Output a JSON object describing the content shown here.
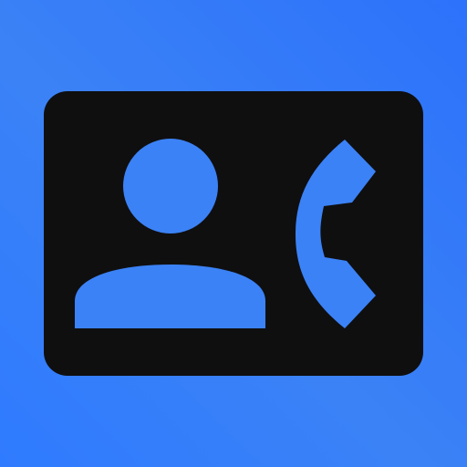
{
  "icon": {
    "name": "contact-phone-icon",
    "background_color": "#3b82f6",
    "card_color": "#0f0f10",
    "glyph_color": "#3b82f6",
    "parts": [
      "person-icon",
      "phone-handset-icon"
    ]
  }
}
